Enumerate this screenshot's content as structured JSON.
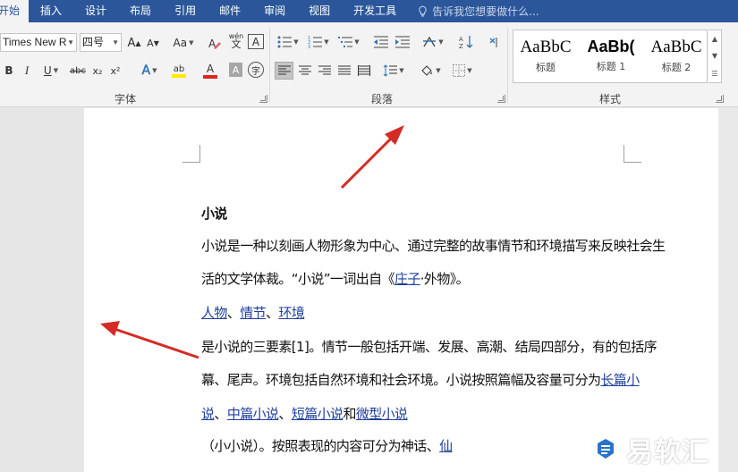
{
  "tabs": [
    "开始",
    "插入",
    "设计",
    "布局",
    "引用",
    "邮件",
    "审阅",
    "视图",
    "开发工具"
  ],
  "tell_me": "告诉我您想要做什么...",
  "font": {
    "name": "Times New R",
    "size": "四号",
    "grow": "A",
    "shrink": "A",
    "case": "Aa",
    "phonetic": "wén",
    "border_char": "A",
    "bold": "B",
    "italic": "I",
    "underline": "U",
    "strike": "abc",
    "subscript": "x₂",
    "superscript": "x²",
    "effects": "A",
    "highlight": "ab",
    "font_color": "A",
    "shading": "A",
    "enclose": "字",
    "group_label": "字体"
  },
  "paragraph": {
    "group_label": "段落"
  },
  "styles": {
    "items": [
      {
        "sample": "AaBbC",
        "name": "标题"
      },
      {
        "sample": "AaBb(",
        "name": "标题 1"
      },
      {
        "sample": "AaBbC",
        "name": "标题 2"
      }
    ],
    "group_label": "样式"
  },
  "document": {
    "title": "小说",
    "line1": "小说是一种以刻画人物形象为中心、通过完整的故事情节和环境描写来反映社会生",
    "line2_pre": "活的文学体裁。“小说”一词出自《",
    "line2_link": "庄子",
    "line2_post": "·外物》。",
    "line3_l1": "人物",
    "line3_s1": "、",
    "line3_l2": "情节",
    "line3_s2": "、",
    "line3_l3": "环境",
    "line4": "是小说的三要素[1]。情节一般包括开端、发展、高潮、结局四部分，有的包括序",
    "line5_pre": "幕、尾声。环境包括自然环境和社会环境。小说按照篇幅及容量可分为",
    "line5_link": "长篇小",
    "line6_link0": "说",
    "line6_s0": "、",
    "line6_l1": "中篇小说",
    "line6_s1": "、",
    "line6_l2": "短篇小说",
    "line6_s2": "和",
    "line6_l3": "微型小说",
    "line7_pre": "（小小说）。按照表现的内容可分为神话、",
    "line7_link": "仙"
  },
  "watermark": "易软汇",
  "colors": {
    "ribbon_tab": "#2b579a",
    "arrow": "#d42b26",
    "link": "#1f3f9e",
    "highlight_bar": "#ffeb00",
    "font_color_bar": "#e2231a"
  }
}
